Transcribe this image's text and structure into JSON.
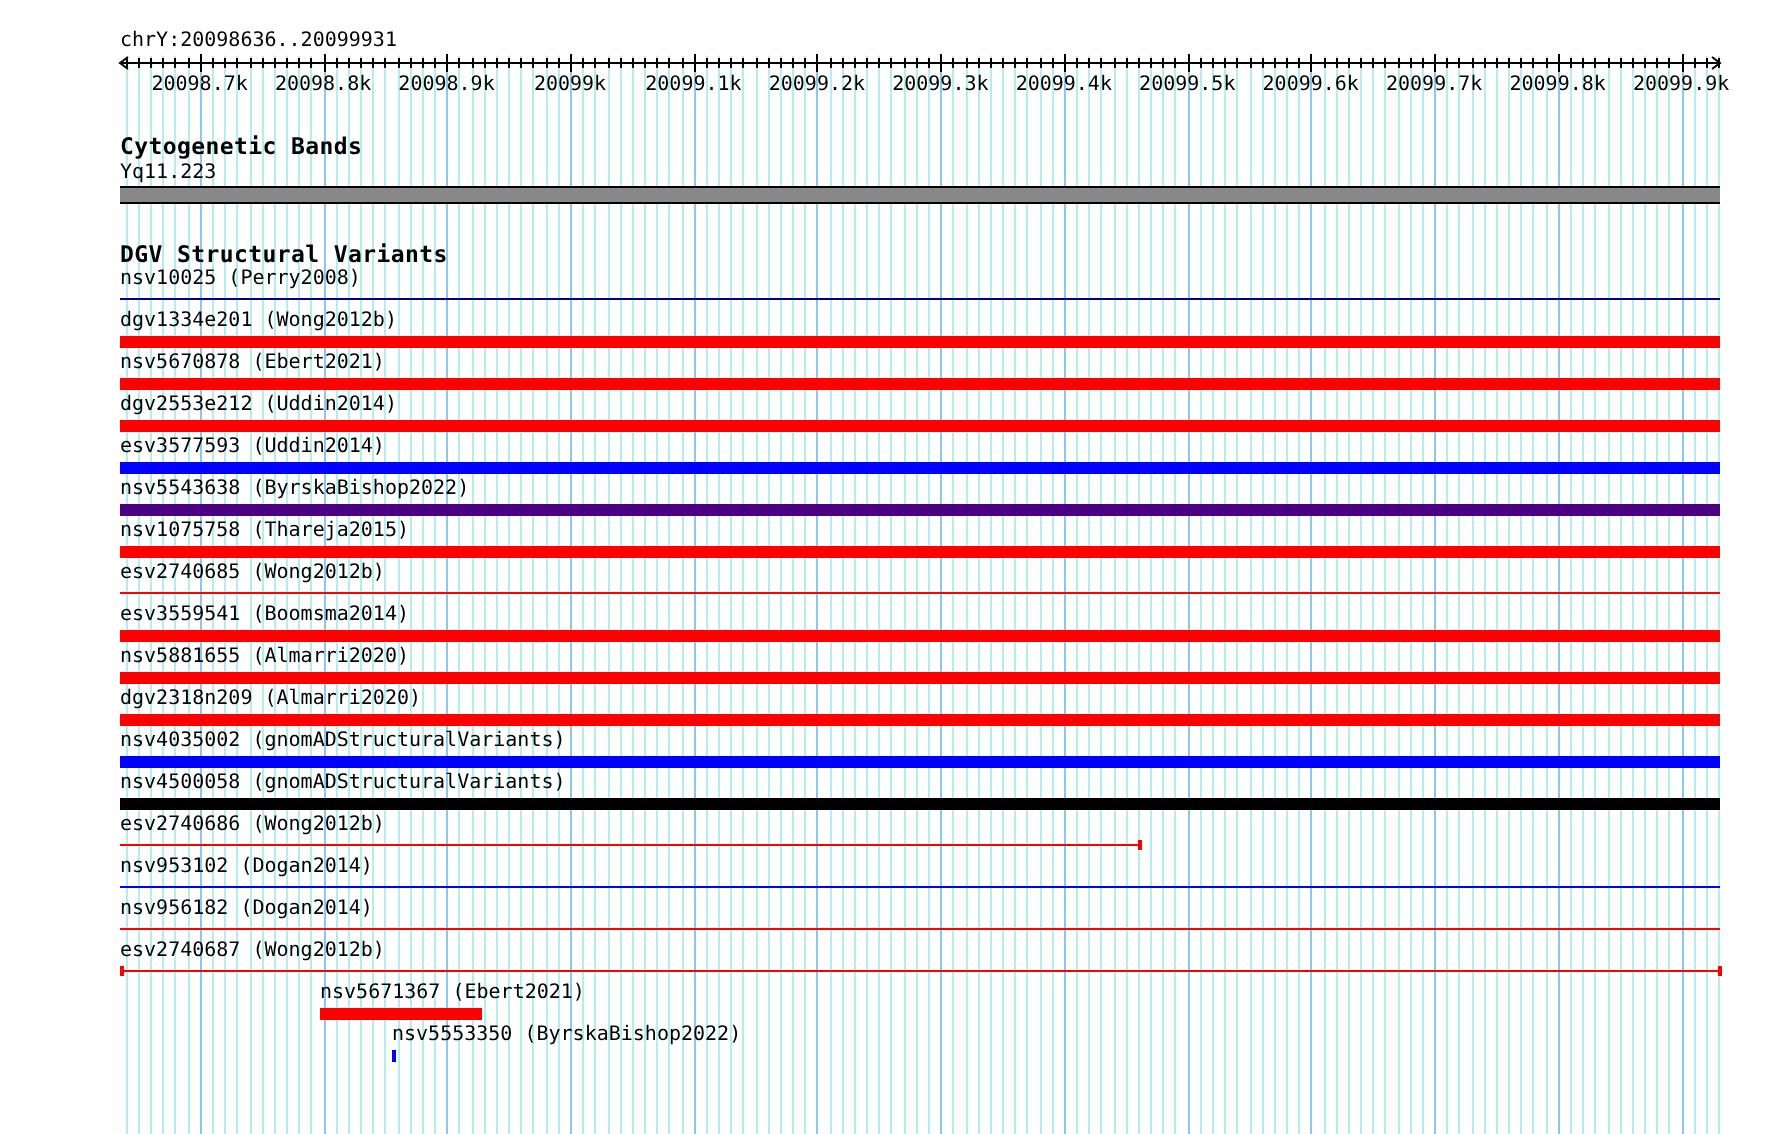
{
  "ruler": {
    "position": "chrY:20098636..20099931",
    "ticks": [
      "20098.7k",
      "20098.8k",
      "20098.9k",
      "20099k",
      "20099.1k",
      "20099.2k",
      "20099.3k",
      "20099.4k",
      "20099.5k",
      "20099.6k",
      "20099.7k",
      "20099.8k",
      "20099.9k"
    ]
  },
  "cytogenetic_bands": {
    "title": "Cytogenetic Bands",
    "band": "Yq11.223"
  },
  "dgv": {
    "title": "DGV Structural Variants",
    "variants": [
      {
        "label": "nsv10025 (Perry2008)",
        "kind": "thin",
        "color": "#000080"
      },
      {
        "label": "dgv1334e201 (Wong2012b)",
        "kind": "thick",
        "color": "#ff0000"
      },
      {
        "label": "nsv5670878 (Ebert2021)",
        "kind": "thick",
        "color": "#ff0000"
      },
      {
        "label": "dgv2553e212 (Uddin2014)",
        "kind": "thick",
        "color": "#ff0000"
      },
      {
        "label": "esv3577593 (Uddin2014)",
        "kind": "thick",
        "color": "#0000ff"
      },
      {
        "label": "nsv5543638 (ByrskaBishop2022)",
        "kind": "thick",
        "color": "#4b0082"
      },
      {
        "label": "nsv1075758 (Thareja2015)",
        "kind": "thick",
        "color": "#ff0000"
      },
      {
        "label": "esv2740685 (Wong2012b)",
        "kind": "thin",
        "color": "#ff0000"
      },
      {
        "label": "esv3559541 (Boomsma2014)",
        "kind": "thick",
        "color": "#ff0000"
      },
      {
        "label": "nsv5881655 (Almarri2020)",
        "kind": "thick",
        "color": "#ff0000"
      },
      {
        "label": "dgv2318n209 (Almarri2020)",
        "kind": "thick",
        "color": "#ff0000"
      },
      {
        "label": "nsv4035002 (gnomADStructuralVariants)",
        "kind": "thick",
        "color": "#0000ff"
      },
      {
        "label": "nsv4500058 (gnomADStructuralVariants)",
        "kind": "thick",
        "color": "#000000"
      },
      {
        "label": "esv2740686 (Wong2012b)",
        "kind": "thin",
        "color": "#ff0000"
      },
      {
        "label": "nsv953102 (Dogan2014)",
        "kind": "thin",
        "color": "#0000ff"
      },
      {
        "label": "nsv956182 (Dogan2014)",
        "kind": "thin",
        "color": "#ff0000"
      },
      {
        "label": "esv2740687 (Wong2012b)",
        "kind": "thin",
        "color": "#ff0000"
      },
      {
        "label": "nsv5671367 (Ebert2021)",
        "kind": "thick",
        "color": "#ff0000"
      },
      {
        "label": "nsv5553350 (ByrskaBishop2022)",
        "kind": "thick",
        "color": "#0000ff"
      }
    ]
  }
}
